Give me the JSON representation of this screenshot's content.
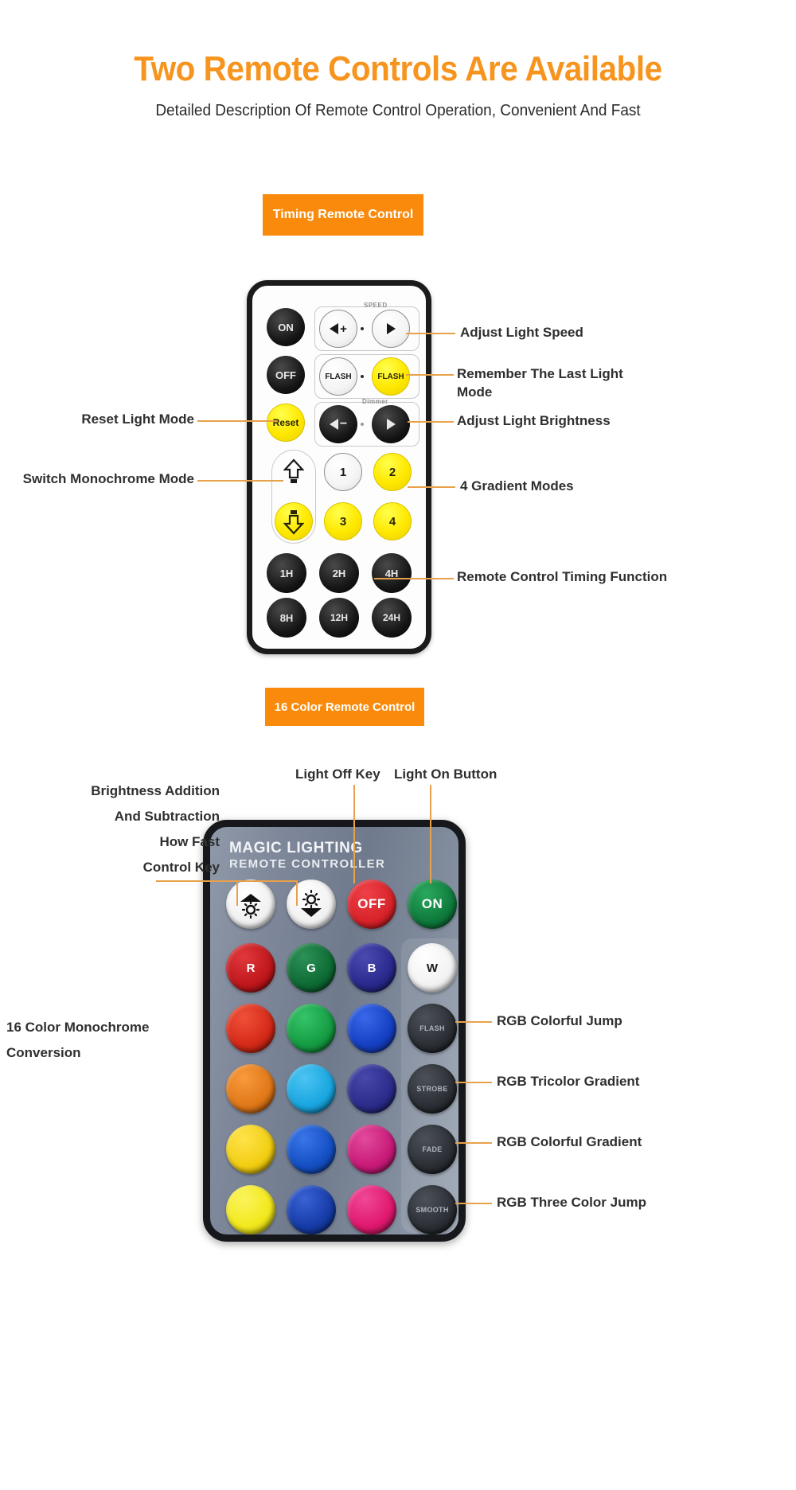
{
  "header": {
    "title": "Two Remote Controls Are Available",
    "subtitle": "Detailed Description Of Remote Control Operation, Convenient And Fast",
    "title_color": "#F7941E",
    "subtitle_color": "#2b2b2b"
  },
  "badges": {
    "timing": "Timing Remote Control",
    "sixteen_color": "16 Color Remote Control",
    "color": "#F98A0B"
  },
  "remote1": {
    "name": "Timing Remote Control",
    "body_color": "#fdfdfd",
    "bezel_color": "#1b1b1b",
    "group_labels": {
      "speed": "SPEED",
      "dimmer": "Dimmer"
    },
    "buttons": {
      "on": "ON",
      "off": "OFF",
      "reset": "Reset",
      "flash_white": "FLASH",
      "flash_yellow": "FLASH",
      "speed_down": "◀+",
      "speed_up": "▶",
      "dim_down": "◀−",
      "dim_up": "▶",
      "mode1": "1",
      "mode2": "2",
      "mode3": "3",
      "mode4": "4",
      "timers": [
        "1H",
        "2H",
        "4H",
        "8H",
        "12H",
        "24H"
      ]
    },
    "annotations": {
      "right": [
        "Adjust Light Speed",
        "Remember The Last Light\nMode",
        "Adjust Light Brightness",
        "4 Gradient Modes",
        "Remote Control Timing Function"
      ],
      "left": [
        "Reset Light Mode",
        "Switch Monochrome Mode"
      ]
    }
  },
  "remote2": {
    "name": "16 Color Remote Control",
    "brand_line1": "MAGIC LIGHTING",
    "brand_line2": "REMOTE CONTROLLER",
    "body_color": "#7e889a",
    "bezel_color": "#16181c",
    "top_row": {
      "brightness_up": "brightness-up-icon",
      "brightness_down": "brightness-down-icon",
      "off": "OFF",
      "on": "ON",
      "off_color": "#D8232A",
      "on_color": "#0F7B3C"
    },
    "function_buttons": [
      "FLASH",
      "STROBE",
      "FADE",
      "SMOOTH"
    ],
    "color_grid": [
      [
        "R",
        "G",
        "B",
        "W"
      ],
      [
        "",
        "",
        "",
        ""
      ],
      [
        "",
        "",
        "",
        ""
      ],
      [
        "",
        "",
        "",
        ""
      ],
      [
        "",
        "",
        "",
        ""
      ]
    ],
    "color_grid_hex": [
      [
        "#C0171C",
        "#0E6B34",
        "#2A2A8E",
        "#FFFFFF"
      ],
      [
        "#D42A18",
        "#159C43",
        "#1540C4",
        null
      ],
      [
        "#E07818",
        "#19A6E0",
        "#2C2C8C",
        null
      ],
      [
        "#F2CE12",
        "#1450C4",
        "#C81A78",
        null
      ],
      [
        "#F2E81C",
        "#153CA8",
        "#E0186E",
        null
      ]
    ],
    "annotations": {
      "top": [
        "Light Off Key",
        "Light On Button"
      ],
      "left_block": "Brightness Addition\nAnd Subtraction\nHow Fast\nControl Key",
      "left_lower": "16 Color Monochrome\n    Conversion",
      "right": [
        "RGB Colorful Jump",
        "RGB Tricolor Gradient",
        "RGB Colorful Gradient",
        "RGB Three Color Jump"
      ]
    }
  }
}
